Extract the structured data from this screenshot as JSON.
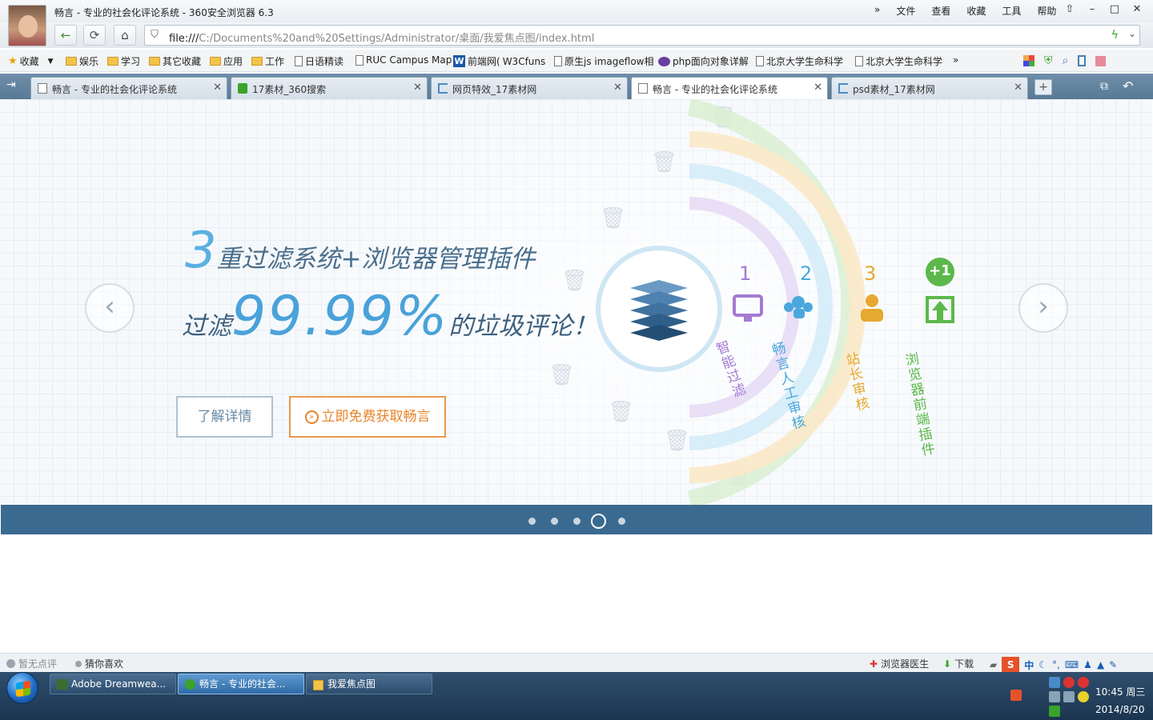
{
  "window": {
    "title": "畅言 - 专业的社会化评论系统 - 360安全浏览器 6.3",
    "menu": [
      "»",
      "文件",
      "查看",
      "收藏",
      "工具",
      "帮助"
    ]
  },
  "address": {
    "url_prefix": "file:///",
    "url_rest": "C:/Documents%20and%20Settings/Administrator/桌面/我爱焦点图/index.html"
  },
  "bookmarks": [
    {
      "label": "收藏"
    },
    {
      "label": "娱乐"
    },
    {
      "label": "学习"
    },
    {
      "label": "其它收藏"
    },
    {
      "label": "应用"
    },
    {
      "label": "工作"
    },
    {
      "label": "日语精读"
    },
    {
      "label": "RUC Campus Map"
    },
    {
      "label": "前端网("
    },
    {
      "label": "W3Cfuns"
    },
    {
      "label": "原生js imageflow相"
    },
    {
      "label": "php面向对象详解"
    },
    {
      "label": "北京大学生命科学"
    },
    {
      "label": "北京大学生命科学"
    },
    {
      "label": "»"
    }
  ],
  "tabs": [
    {
      "label": "畅言 - 专业的社会化评论系统"
    },
    {
      "label": "17素材_360搜索"
    },
    {
      "label": "网页特效_17素材网"
    },
    {
      "label": "畅言 - 专业的社会化评论系统"
    },
    {
      "label": "psd素材_17素材网"
    }
  ],
  "banner": {
    "line1_num": "3",
    "line1_text": "重过滤系统+浏览器管理插件",
    "line2_pre": "过滤",
    "line2_num": "99.99%",
    "line2_post": "的垃圾评论！",
    "btn_detail": "了解详情",
    "btn_get": "立即免费获取畅言",
    "btn_get_icon": "»",
    "arrow_left": "‹",
    "arrow_right": "›",
    "rings": [
      {
        "num": "1",
        "label": "智能过滤",
        "color": "#a47ad4"
      },
      {
        "num": "2",
        "label": "畅言人工审核",
        "color": "#4aa8dc"
      },
      {
        "num": "3",
        "label": "站长审核",
        "color": "#e6a830"
      },
      {
        "num": "+1",
        "label": "浏览器前端插件",
        "color": "#5bb84a"
      }
    ],
    "active_slide": 4,
    "slide_count": 5
  },
  "status": {
    "left1": "暂无点评",
    "left2": "猜你喜欢",
    "doctor": "浏览器医生",
    "download": "下载",
    "ime": "中"
  },
  "taskbar": {
    "tasks": [
      {
        "label": "Adobe Dreamwea..."
      },
      {
        "label": "畅言 - 专业的社会..."
      },
      {
        "label": "我爱焦点图"
      }
    ],
    "time": "10:45 周三",
    "date": "2014/8/20"
  }
}
